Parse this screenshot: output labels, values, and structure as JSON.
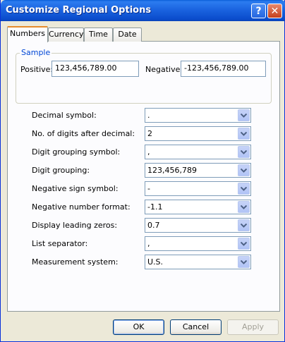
{
  "window": {
    "title": "Customize Regional Options"
  },
  "titlebar": {
    "help_label": "?",
    "close_label": "✕"
  },
  "tabs": [
    {
      "label": "Numbers",
      "active": true
    },
    {
      "label": "Currency",
      "active": false
    },
    {
      "label": "Time",
      "active": false
    },
    {
      "label": "Date",
      "active": false
    }
  ],
  "sample": {
    "title": "Sample",
    "positive_label": "Positive:",
    "positive_value": "123,456,789.00",
    "negative_label": "Negative:",
    "negative_value": "-123,456,789.00"
  },
  "settings": [
    {
      "label": "Decimal symbol:",
      "value": "."
    },
    {
      "label": "No. of digits after decimal:",
      "value": "2"
    },
    {
      "label": "Digit grouping symbol:",
      "value": ","
    },
    {
      "label": "Digit grouping:",
      "value": "123,456,789"
    },
    {
      "label": "Negative sign symbol:",
      "value": "-"
    },
    {
      "label": "Negative number format:",
      "value": "-1.1"
    },
    {
      "label": "Display leading zeros:",
      "value": "0.7"
    },
    {
      "label": "List separator:",
      "value": ","
    },
    {
      "label": "Measurement system:",
      "value": "U.S."
    }
  ],
  "buttons": {
    "ok": "OK",
    "cancel": "Cancel",
    "apply": "Apply"
  },
  "colors": {
    "titlebar": "#0a4ccc",
    "accent_tab": "#e68b2c",
    "group_title": "#0046d5"
  }
}
